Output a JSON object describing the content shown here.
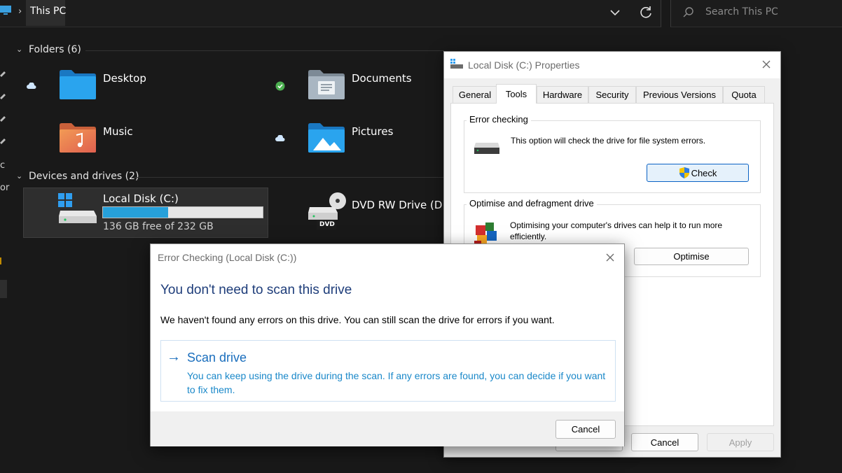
{
  "explorer": {
    "breadcrumb": "This PC",
    "search_placeholder": "Search This PC",
    "folders_header": "Folders (6)",
    "drives_header": "Devices and drives (2)",
    "strip_text": [
      "c",
      "or"
    ],
    "folders": [
      {
        "label": "Desktop",
        "status": "cloud-icon"
      },
      {
        "label": "Documents",
        "status": "synced-check-icon"
      },
      {
        "label": "Music",
        "status": "none"
      },
      {
        "label": "Pictures",
        "status": "cloud-icon"
      }
    ],
    "drives": [
      {
        "label": "Local Disk (C:)",
        "free_text": "136 GB free of 232 GB",
        "used_fraction": 0.41
      },
      {
        "label": "DVD RW Drive (D:)",
        "badge": "DVD"
      }
    ]
  },
  "properties": {
    "title": "Local Disk (C:) Properties",
    "tabs": [
      "General",
      "Tools",
      "Hardware",
      "Security",
      "Previous Versions",
      "Quota"
    ],
    "active_tab": "Tools",
    "error_checking": {
      "title": "Error checking",
      "text": "This option will check the drive for file system errors.",
      "button": "Check"
    },
    "optimise": {
      "title": "Optimise and defragment drive",
      "text": "Optimising your computer's drives can help it to run more efficiently.",
      "button": "Optimise"
    },
    "footer": {
      "cancel": "Cancel",
      "apply": "Apply"
    }
  },
  "error_dialog": {
    "title": "Error Checking (Local Disk (C:))",
    "heading": "You don't need to scan this drive",
    "message": "We haven't found any errors on this drive. You can still scan the drive for errors if you want.",
    "scan_arrow": "→",
    "scan_title": "Scan drive",
    "scan_description": "You can keep using the drive during the scan. If any errors are found, you can decide if you want to fix them.",
    "cancel": "Cancel"
  },
  "colors": {
    "accent": "#26a0da",
    "link_blue": "#1a6ebd",
    "heading_blue": "#1e3d7a",
    "dark_bg": "#191919"
  }
}
